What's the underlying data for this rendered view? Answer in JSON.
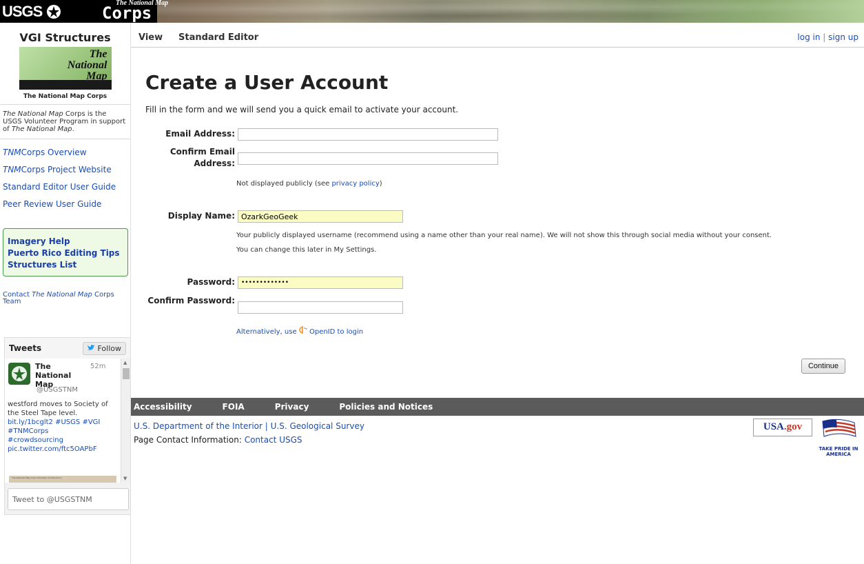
{
  "banner": {
    "usgs": "USGS",
    "ntm": "The National Map",
    "corps": "Corps"
  },
  "sidebar": {
    "title": "VGI Structures",
    "logo_lines": [
      "The",
      "National",
      "Map"
    ],
    "logo_caption": "The National Map Corps",
    "description": [
      "The National Map",
      " Corps is the USGS Volunteer Program in support of ",
      "The National Map",
      "."
    ],
    "links": [
      {
        "em": "TNM",
        "rest": "Corps Overview"
      },
      {
        "em": "TNM",
        "rest": "Corps Project Website"
      },
      {
        "em": "",
        "rest": "Standard Editor User Guide"
      },
      {
        "em": "",
        "rest": "Peer Review User Guide"
      }
    ],
    "help_links": [
      "Imagery Help",
      "Puerto Rico Editing Tips",
      "Structures List"
    ],
    "contact": [
      "Contact ",
      "The National Map",
      " Corps Team"
    ]
  },
  "tweets": {
    "title": "Tweets",
    "follow": "Follow",
    "name": "The National Map",
    "time": "52m",
    "handle": "@USGSTNM",
    "text": "westford  moves to Society of the Steel Tape level.",
    "links": [
      "bit.ly/1bcglt2",
      "#USGS",
      "#VGI",
      "#TNMCorps",
      "#crowdsourcing",
      "pic.twitter.com/ftc5OAPbF"
    ],
    "thumb_caption": "The National Map Corps Volunteer Contributions",
    "input_placeholder": "Tweet to @USGSTNM"
  },
  "topnav": {
    "view": "View",
    "editor": "Standard Editor",
    "login": "log in",
    "sep": "|",
    "signup": "sign up"
  },
  "form": {
    "title": "Create a User Account",
    "intro": "Fill in the form and we will send you a quick email to activate your account.",
    "email_label": "Email Address:",
    "confirm_email_label": "Confirm Email Address:",
    "email_note_pre": "Not displayed publicly (see ",
    "privacy_link": "privacy policy",
    "email_note_post": ")",
    "display_label": "Display Name:",
    "display_value": "OzarkGeoGeek",
    "display_note": "Your publicly displayed username (recommend using a name other than your real name). We will not show this through social media without your consent.",
    "display_note2": "You can change this later in My Settings.",
    "password_label": "Password:",
    "password_value": "•••••••••••••",
    "confirm_password_label": "Confirm Password:",
    "openid_pre": "Alternatively, use ",
    "openid_post": " OpenID to login",
    "continue": "Continue"
  },
  "footer": {
    "nav": [
      "Accessibility",
      "FOIA",
      "Privacy",
      "Policies and Notices"
    ],
    "doi": "U.S. Department of the Interior",
    "sep": " | ",
    "usgs": "U.S. Geological Survey",
    "contact_label": "Page Contact Information: ",
    "contact_link": "Contact USGS",
    "usagov_usa": "USA",
    "usagov_gov": ".gov",
    "pride": "TAKE PRIDE IN AMERICA"
  },
  "colors": {
    "link": "#1a4db3",
    "footer_bar": "#5b5b5b",
    "filled_input": "#fbfbc4",
    "help_box_border": "#4a9a4a"
  }
}
